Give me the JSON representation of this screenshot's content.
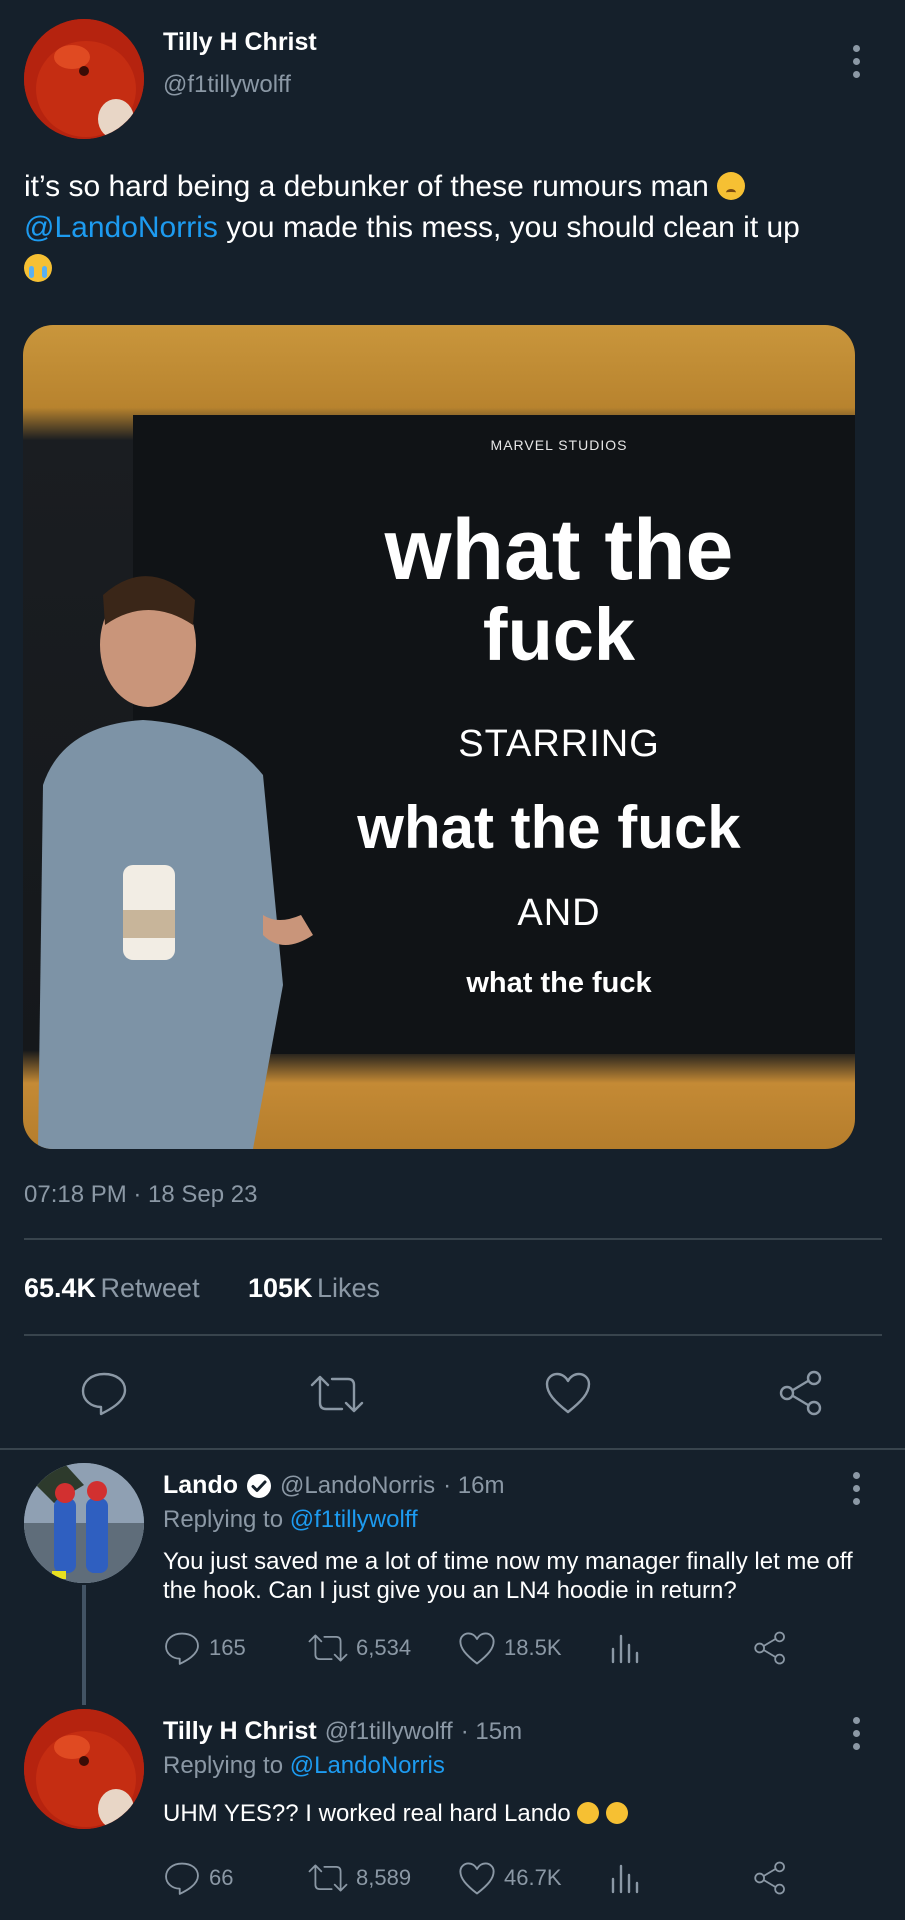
{
  "main_tweet": {
    "author_name": "Tilly H Christ",
    "author_handle": "@f1tillywolff",
    "text_part1": "it’s so hard being a debunker of these rumours man",
    "mention": "@LandoNorris",
    "text_part2": " you made this mess, you should clean it up",
    "emoji_1": "pleading-face-emoji",
    "emoji_2": "loudly-crying-face-emoji",
    "meme": {
      "brand": "MARVEL STUDIOS",
      "line1": "what the",
      "line2": "fuck",
      "line3": "STARRING",
      "line4": "what the fuck",
      "line5": "AND",
      "line6": "what the fuck"
    },
    "timestamp": "07:18 PM · 18 Sep 23",
    "retweets_count": "65.4K",
    "retweets_label": "Retweet",
    "likes_count": "105K",
    "likes_label": "Likes"
  },
  "replies": [
    {
      "author_name": "Lando",
      "verified": true,
      "author_handle": "@LandoNorris",
      "time": "· 16m",
      "replying_prefix": "Replying to",
      "replying_to": "@f1tillywolff",
      "text": "You just saved me a lot of time now my manager finally let me off the hook. Can I just give you an LN4 hoodie in return?",
      "reply_count": "165",
      "retweet_count": "6,534",
      "like_count": "18.5K"
    },
    {
      "author_name": "Tilly H Christ",
      "author_handle": "@f1tillywolff",
      "time": "· 15m",
      "replying_prefix": "Replying to",
      "replying_to": "@LandoNorris",
      "text": "UHM YES?? I worked real hard Lando",
      "reply_count": "66",
      "retweet_count": "8,589",
      "like_count": "46.7K"
    }
  ],
  "colors": {
    "background": "#15202b",
    "link": "#1d9bf0",
    "secondary_text": "#8b98a5",
    "divider": "#38444d"
  }
}
